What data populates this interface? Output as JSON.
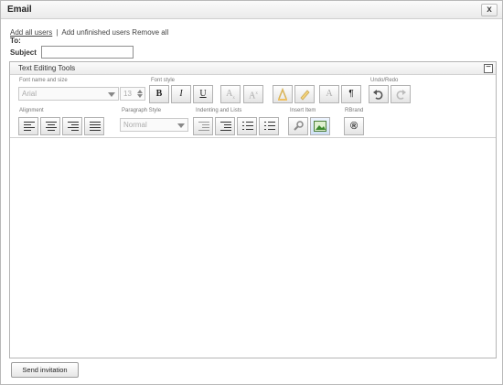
{
  "dialog": {
    "title": "Email",
    "close_label": "x"
  },
  "recipients": {
    "add_all_label": "Add all users",
    "separator": "|",
    "add_unfinished_label": "Add unfinished users",
    "remove_all_label": "Remove all"
  },
  "fields": {
    "to_label": "To:",
    "subject_label": "Subject",
    "subject_value": ""
  },
  "editor": {
    "title": "Text Editing Tools",
    "collapse_label": "−",
    "groups": {
      "font_name_size": "Font name and size",
      "font_style": "Font style",
      "undo_redo": "Undo/Redo",
      "alignment": "Alignment",
      "paragraph_style": "Paragraph Style",
      "indenting_lists": "Indenting and Lists",
      "insert_item": "Insert Item",
      "rebrand": "RBrand"
    },
    "font_name_value": "Arial",
    "font_size_value": "13",
    "paragraph_style_value": "Normal",
    "buttons": {
      "bold": "B",
      "italic": "I",
      "underline": "U",
      "subscript": "A",
      "superscript": "A",
      "paragraph": "¶",
      "brand": "®"
    },
    "content": ""
  },
  "footer": {
    "send_label": "Send invitation"
  }
}
